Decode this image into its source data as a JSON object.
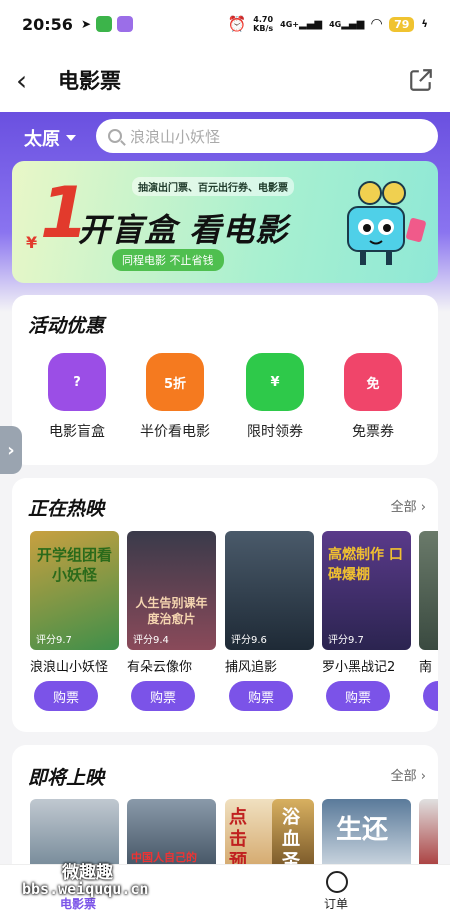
{
  "status": {
    "time": "20:56",
    "net_speed": "4.70",
    "net_unit": "KB/s",
    "sig1": "4G+",
    "sig2": "4G",
    "battery": "79"
  },
  "nav": {
    "title": "电影票"
  },
  "header": {
    "city": "太原",
    "search_placeholder": "浪浪山小妖怪"
  },
  "banner": {
    "subtitle": "抽演出门票、百元出行券、电影票",
    "yen": "¥",
    "big_number": "1",
    "main": "开盲盒 看电影",
    "tag": "同程电影 不止省钱"
  },
  "activity": {
    "title": "活动优惠",
    "items": [
      {
        "label": "电影盲盒",
        "icon_text": "?",
        "color": "#9b4ee6"
      },
      {
        "label": "半价看电影",
        "icon_text": "5折",
        "color": "#f57a1f"
      },
      {
        "label": "限时领券",
        "icon_text": "¥",
        "color": "#2ec94a"
      },
      {
        "label": "免票券",
        "icon_text": "免",
        "color": "#f0456a"
      }
    ]
  },
  "now_showing": {
    "title": "正在热映",
    "more": "全部",
    "movies": [
      {
        "title": "浪浪山小妖怪",
        "score": "评分9.7",
        "buy": "购票",
        "poster_text": "开学组团看小妖怪",
        "colors": [
          "#3f8f4a",
          "#c8a040"
        ]
      },
      {
        "title": "有朵云像你",
        "score": "评分9.4",
        "buy": "购票",
        "poster_text": "人生告别课年度治愈片",
        "colors": [
          "#2a2a3a",
          "#8a4a5a"
        ]
      },
      {
        "title": "捕风追影",
        "score": "评分9.6",
        "buy": "购票",
        "poster_text": "",
        "colors": [
          "#1e2a36",
          "#4a5a6a"
        ]
      },
      {
        "title": "罗小黑战记2",
        "score": "评分9.7",
        "buy": "购票",
        "poster_text": "高燃制作 口碑爆棚",
        "colors": [
          "#2b2450",
          "#5a3a8a"
        ]
      },
      {
        "title": "南",
        "score": "",
        "buy": "购票",
        "poster_text": "",
        "colors": [
          "#3a4a40",
          "#6a7a6a"
        ]
      }
    ]
  },
  "upcoming": {
    "title": "即将上映",
    "more": "全部",
    "posters": [
      {
        "text": "",
        "colors": [
          "#6a8090",
          "#c0c8d0"
        ]
      },
      {
        "text": "中国人自己的",
        "colors": [
          "#8a9aaa",
          "#3a4a5a"
        ]
      },
      {
        "text": "点击预",
        "colors": [
          "#f0e0c0",
          "#c03030"
        ]
      },
      {
        "text": "浴血圣",
        "colors": [
          "#d8b060",
          "#6a4a20"
        ]
      },
      {
        "text": "生还",
        "colors": [
          "#5a7a9a",
          "#dfe6ec"
        ]
      },
      {
        "text": "",
        "colors": [
          "#e0e0e0",
          "#a02020"
        ]
      }
    ]
  },
  "tabs": {
    "movie": "电影票",
    "order": "订单"
  },
  "watermark": {
    "line1": "微趣趣",
    "line2": "bbs.weiququ.cn"
  }
}
